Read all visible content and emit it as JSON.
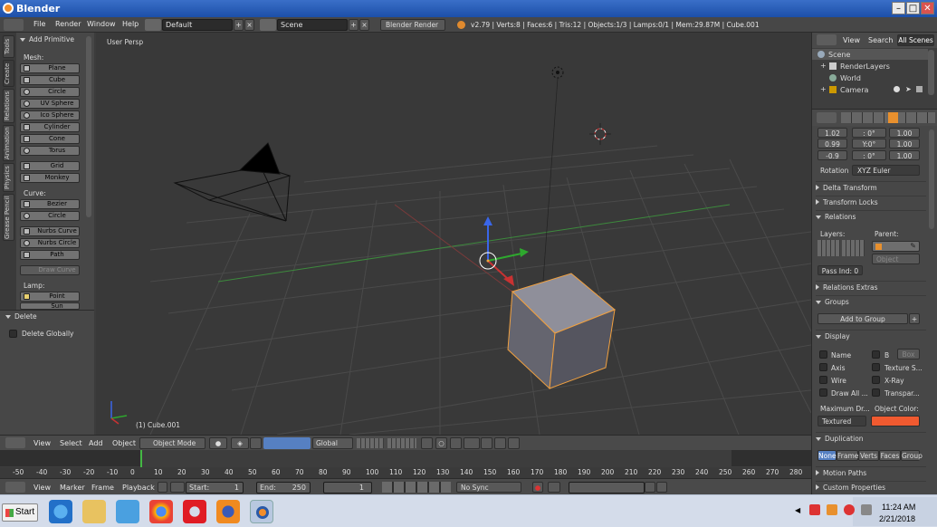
{
  "window": {
    "title": "Blender"
  },
  "infobar": {
    "menus": [
      "File",
      "Render",
      "Window",
      "Help"
    ],
    "layout": "Default",
    "scene": "Scene",
    "engine": "Blender Render",
    "stats": "v2.79 | Verts:8 | Faces:6 | Tris:12 | Objects:1/3 | Lamps:0/1 | Mem:29.87M | Cube.001"
  },
  "tool_tabs": [
    "Tools",
    "Create",
    "Relations",
    "Animation",
    "Physics",
    "Grease Pencil"
  ],
  "toolshelf": {
    "title": "Add Primitive",
    "mesh_label": "Mesh:",
    "mesh": [
      "Plane",
      "Cube",
      "Circle",
      "UV Sphere",
      "Ico Sphere",
      "Cylinder",
      "Cone",
      "Torus"
    ],
    "mesh2": [
      "Grid",
      "Monkey"
    ],
    "curve_label": "Curve:",
    "curve": [
      "Bezier",
      "Circle"
    ],
    "curve2": [
      "Nurbs Curve",
      "Nurbs Circle",
      "Path"
    ],
    "draw_curve": "Draw Curve",
    "lamp_label": "Lamp:",
    "lamp": [
      "Point",
      "Sun"
    ]
  },
  "operator": {
    "title": "Delete",
    "option": "Delete Globally"
  },
  "viewport": {
    "view_name": "User Persp",
    "object_label": "(1) Cube.001"
  },
  "vp_header": {
    "menus": [
      "View",
      "Select",
      "Add",
      "Object"
    ],
    "mode": "Object Mode",
    "orientation": "Global"
  },
  "timeline": {
    "ticks": [
      "-50",
      "-40",
      "-30",
      "-20",
      "-10",
      "0",
      "10",
      "20",
      "30",
      "40",
      "50",
      "60",
      "70",
      "80",
      "90",
      "100",
      "110",
      "120",
      "130",
      "140",
      "150",
      "160",
      "170",
      "180",
      "190",
      "200",
      "210",
      "220",
      "230",
      "240",
      "250",
      "260",
      "270",
      "280"
    ]
  },
  "tl_header": {
    "menus": [
      "View",
      "Marker",
      "Frame",
      "Playback"
    ],
    "start_label": "Start:",
    "start": "1",
    "end_label": "End:",
    "end": "250",
    "current": "1",
    "sync": "No Sync"
  },
  "outliner": {
    "menus": [
      "View",
      "Search"
    ],
    "filter": "All Scenes",
    "items": [
      "Scene",
      "RenderLayers",
      "World",
      "Camera"
    ]
  },
  "properties": {
    "transform": {
      "location": [
        "1.02",
        "0.99",
        "-0.9"
      ],
      "rotation": [
        "0°",
        "0°",
        "0°"
      ],
      "rotation_labels": [
        ": 0°",
        "Y:0°",
        ": 0°"
      ],
      "scale": [
        "1.00",
        "1.00",
        "1.00"
      ]
    },
    "rotation_label": "Rotation",
    "rotation_mode": "XYZ Euler",
    "panels_closed1": [
      "Delta Transform",
      "Transform Locks"
    ],
    "relations": {
      "title": "Relations",
      "layers_label": "Layers:",
      "parent_label": "Parent:",
      "parent_type": "Object",
      "pass_index": "Pass Ind: 0"
    },
    "panels_closed2": [
      "Relations Extras",
      "Groups"
    ],
    "add_group": "Add to Group",
    "display": {
      "title": "Display",
      "left": [
        "Name",
        "Axis",
        "Wire",
        "Draw All ..."
      ],
      "right": [
        "B",
        "Texture S...",
        "X-Ray",
        "Transpar..."
      ],
      "bounds_type": "Box",
      "max_draw_label": "Maximum Dr...",
      "max_draw": "Textured",
      "color_label": "Object Color:",
      "color": "#f05a30"
    },
    "duplication": {
      "title": "Duplication",
      "options": [
        "None",
        "Frame",
        "Verts",
        "Faces",
        "Group"
      ]
    },
    "panels_closed3": [
      "Motion Paths",
      "Custom Properties"
    ]
  },
  "taskbar": {
    "start": "Start",
    "time": "11:24 AM",
    "date": "2/21/2018"
  }
}
